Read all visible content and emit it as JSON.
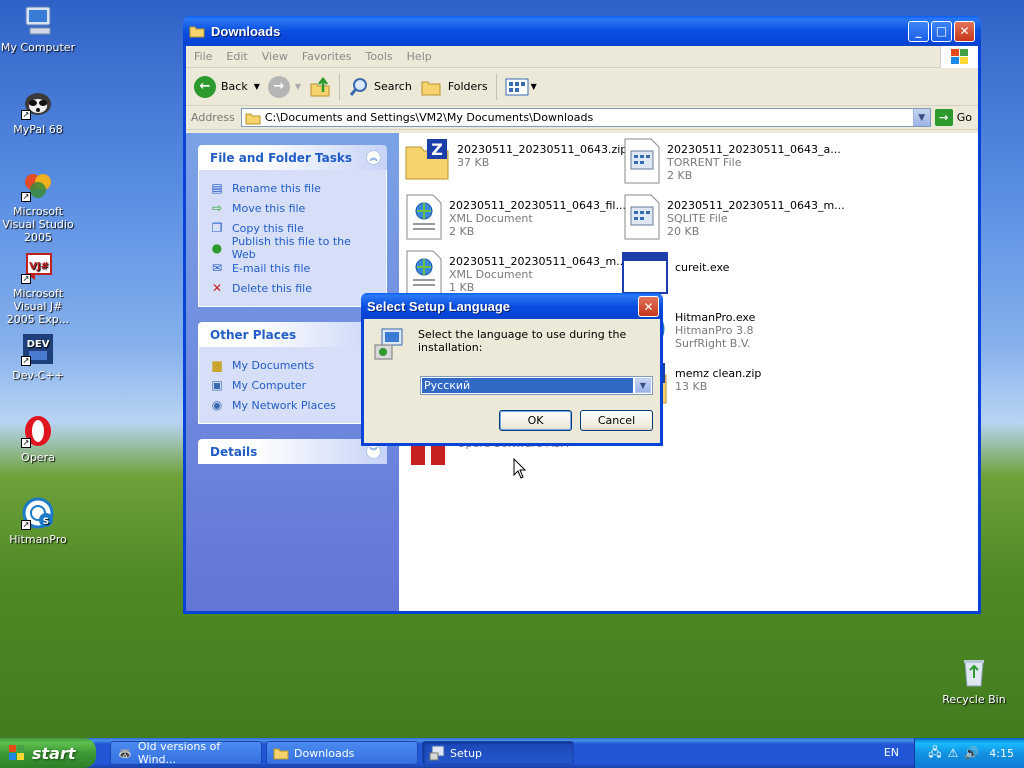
{
  "desktop": {
    "icons": [
      {
        "label": "My Computer"
      },
      {
        "label": "MyPal 68"
      },
      {
        "label": "Microsoft Visual Studio 2005"
      },
      {
        "label": "Microsoft Visual J# 2005 Exp..."
      },
      {
        "label": "Dev-C++"
      },
      {
        "label": "Opera"
      },
      {
        "label": "HitmanPro"
      },
      {
        "label": "Recycle Bin"
      }
    ]
  },
  "window": {
    "title": "Downloads",
    "menu": [
      "File",
      "Edit",
      "View",
      "Favorites",
      "Tools",
      "Help"
    ],
    "toolbar": {
      "back": "Back",
      "search": "Search",
      "folders": "Folders"
    },
    "address": {
      "label": "Address",
      "value": "C:\\Documents and Settings\\VM2\\My Documents\\Downloads",
      "go": "Go"
    }
  },
  "taskpane": {
    "file_tasks": {
      "title": "File and Folder Tasks",
      "items": [
        "Rename this file",
        "Move this file",
        "Copy this file",
        "Publish this file to the Web",
        "E-mail this file",
        "Delete this file"
      ]
    },
    "other_places": {
      "title": "Other Places",
      "items": [
        "My Documents",
        "My Computer",
        "My Network Places"
      ]
    },
    "details": {
      "title": "Details"
    }
  },
  "files": [
    {
      "name": "20230511_20230511_0643.zip",
      "line2": "37 KB",
      "line3": "",
      "icon": "zip-icon"
    },
    {
      "name": "20230511_20230511_0643_a...",
      "line2": "TORRENT File",
      "line3": "2 KB",
      "icon": "file-icon"
    },
    {
      "name": "20230511_20230511_0643_fil...",
      "line2": "XML Document",
      "line3": "2 KB",
      "icon": "xml-icon"
    },
    {
      "name": "20230511_20230511_0643_m...",
      "line2": "SQLITE File",
      "line3": "20 KB",
      "icon": "file-icon"
    },
    {
      "name": "20230511_20230511_0643_m...",
      "line2": "XML Document",
      "line3": "1 KB",
      "icon": "xml-icon"
    },
    {
      "name": "cureit.exe",
      "line2": "",
      "line3": "",
      "icon": "exe-icon"
    },
    {
      "name": "HitmanPro.exe",
      "line2": "HitmanPro 3.8",
      "line3": "SurfRight B.V.",
      "icon": "hitmanpro-icon"
    },
    {
      "name": "memz clean.zip",
      "line2": "13 KB",
      "line3": "",
      "icon": "zip-icon"
    },
    {
      "name": "",
      "line2": "Opera Software ASA",
      "line3": "",
      "icon": "opera-installer-icon"
    }
  ],
  "dialog": {
    "title": "Select Setup Language",
    "message": "Select the language to use during the installation:",
    "selected_language": "Русский",
    "ok": "OK",
    "cancel": "Cancel"
  },
  "taskbar": {
    "start": "start",
    "buttons": [
      {
        "label": "Old versions of Wind..."
      },
      {
        "label": "Downloads"
      },
      {
        "label": "Setup"
      }
    ],
    "lang": "EN",
    "clock": "4:15"
  }
}
